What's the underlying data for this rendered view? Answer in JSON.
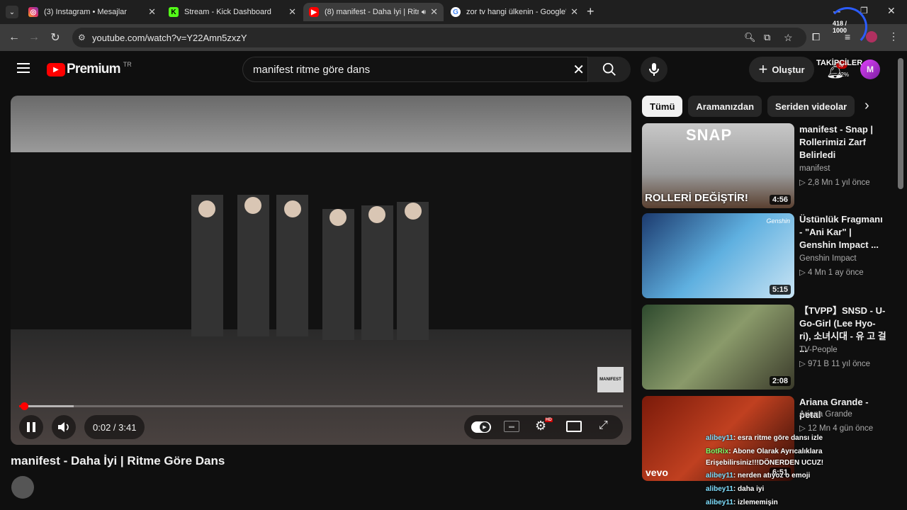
{
  "browser": {
    "tabs": [
      {
        "title": "(3) Instagram • Mesajlar",
        "icon": "instagram-icon",
        "color": "#e1306c"
      },
      {
        "title": "Stream - Kick Dashboard",
        "icon": "kick-icon",
        "color": "#53fc18"
      },
      {
        "title": "(8) manifest - Daha İyi | Ritme",
        "icon": "youtube-icon",
        "color": "#ff0000"
      },
      {
        "title": "zor tv hangi ülkenin - Google'da",
        "icon": "google-icon",
        "color": "#4285f4"
      }
    ],
    "url": "youtube.com/watch?v=Y22Amn5zxzY",
    "overlay_counter": "418 / 1000"
  },
  "youtube": {
    "logo": "Premium",
    "region": "TR",
    "search_query": "manifest ritme göre dans",
    "create_label": "Oluştur",
    "notif_count": "9+",
    "overlay_followers": "TAKİPÇİLER",
    "overlay_pct": "42%"
  },
  "player": {
    "time": "0:02 / 3:41",
    "progress": 0.009,
    "buffered": 0.09,
    "watermark": "MANIFEST",
    "hd_badge": "HD"
  },
  "video": {
    "title": "manifest - Daha İyi | Ritme Göre Dans"
  },
  "filters": [
    "Tümü",
    "Aramanızdan",
    "Seriden videolar"
  ],
  "recommendations": [
    {
      "title": "manifest - Snap | Rollerimizi Zarf Belirledi",
      "channel": "manifest",
      "meta": "▷ 2,8 Mn  1 yıl önce",
      "duration": "4:56",
      "thumb_text": "ROLLERİ DEĞİŞTİR!",
      "thumb_top": "SNAP"
    },
    {
      "title": "Üstünlük Fragmanı - \"Ani Kar\" | Genshin Impact ...",
      "channel": "Genshin Impact",
      "meta": "▷ 4 Mn  1 ay önce",
      "duration": "5:15",
      "thumb_logo": "Genshin"
    },
    {
      "title": "【TVPP】SNSD - U-Go-Girl (Lee Hyo-ri), 소녀시대 - 유 고 걸 ...",
      "channel": "TV-People",
      "meta": "▷ 971 B  11 yıl önce",
      "duration": "2:08"
    },
    {
      "title": "Ariana Grande - petal",
      "channel": "Ariana Grande",
      "meta": "▷ 12 Mn  4 gün önce",
      "duration": "6:51",
      "thumb_logo": "vevo"
    }
  ],
  "chat": [
    {
      "user": "alibey11",
      "text": ": esra ritme göre dansı izle",
      "bot": false
    },
    {
      "user": "BotRix",
      "text": ": Abone Olarak Ayrıcalıklara",
      "bot": true
    },
    {
      "user": "",
      "text": "Erişebilirsiniz!!!DÖNERDEN UCUZ!",
      "bot": false
    },
    {
      "user": "alibey11",
      "text": ": nerden atıyoz o emoji",
      "bot": false
    },
    {
      "user": "alibey11",
      "text": ": daha iyi",
      "bot": false
    },
    {
      "user": "alibey11",
      "text": ": izlememişin",
      "bot": false
    }
  ]
}
